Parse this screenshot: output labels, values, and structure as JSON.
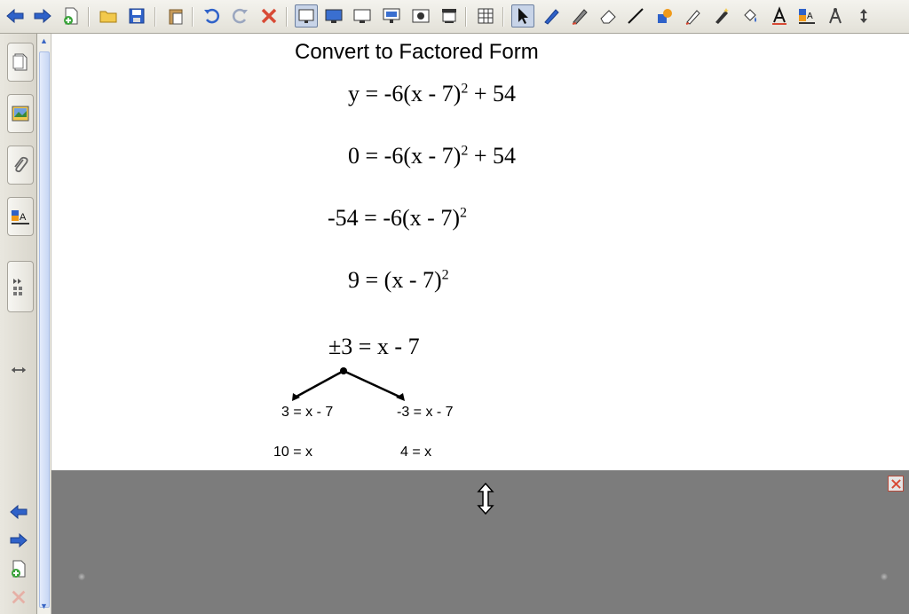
{
  "toolbar": {
    "tools": [
      "back-arrow",
      "forward-arrow",
      "add-page",
      "open-folder",
      "save",
      "paste",
      "undo",
      "redo",
      "delete",
      "full-screen-view",
      "display",
      "screen",
      "presentation",
      "capture",
      "screen-shade",
      "table",
      "select",
      "pen",
      "creative-pen",
      "eraser",
      "line",
      "shape",
      "highlighter",
      "magic-pen",
      "fill",
      "text",
      "properties",
      "measurement",
      "move-toolbar"
    ]
  },
  "canvas": {
    "title": "Convert to Factored Form",
    "lines": [
      {
        "lhs": "y",
        "rhs_pre": "-6(x - 7)",
        "exp": "2",
        "rhs_post": " + 54"
      },
      {
        "lhs": "0",
        "rhs_pre": "-6(x - 7)",
        "exp": "2",
        "rhs_post": " + 54"
      },
      {
        "lhs": "-54",
        "rhs_pre": "-6(x - 7)",
        "exp": "2",
        "rhs_post": ""
      },
      {
        "lhs": "9",
        "rhs_pre": "(x - 7)",
        "exp": "2",
        "rhs_post": ""
      }
    ],
    "pm_line": "±3 = x - 7",
    "branch_left": "3 = x - 7",
    "branch_right": "-3 = x - 7",
    "result_left": "10 = x",
    "result_right": "4 = x"
  },
  "colors": {
    "toolbar_blue": "#2f62c9",
    "panel_gray": "#7c7c7c",
    "close_red": "#d84a35"
  }
}
